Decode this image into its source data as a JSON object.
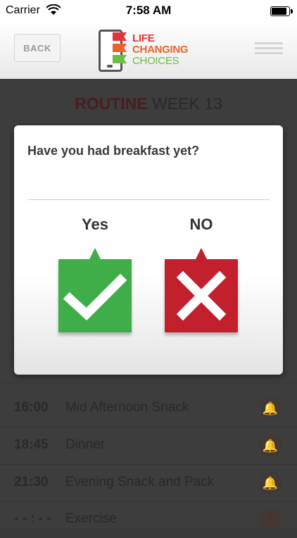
{
  "status_bar": {
    "carrier": "Carrier",
    "time": "7:58 AM"
  },
  "header": {
    "back_label": "BACK",
    "logo_line1": "LIFE",
    "logo_line2": "CHANGING",
    "logo_line3": "CHOICES"
  },
  "page": {
    "title_bold": "ROUTINE",
    "title_rest": " WEEK 13",
    "rows": [
      {
        "time": "16:00",
        "name": "Mid Afternoon Snack",
        "icon": "bell-icon"
      },
      {
        "time": "18:45",
        "name": "Dinner",
        "icon": "bell-icon"
      },
      {
        "time": "21:30",
        "name": "Evening Snack and Pack",
        "icon": "bell-icon"
      },
      {
        "time": "- - : - -",
        "name": "Exercise",
        "icon": "question-icon"
      }
    ]
  },
  "dialog": {
    "question": "Have you had breakfast yet?",
    "yes_label": "Yes",
    "no_label": "NO",
    "colors": {
      "yes": "#3fae49",
      "no": "#c3202e"
    }
  }
}
